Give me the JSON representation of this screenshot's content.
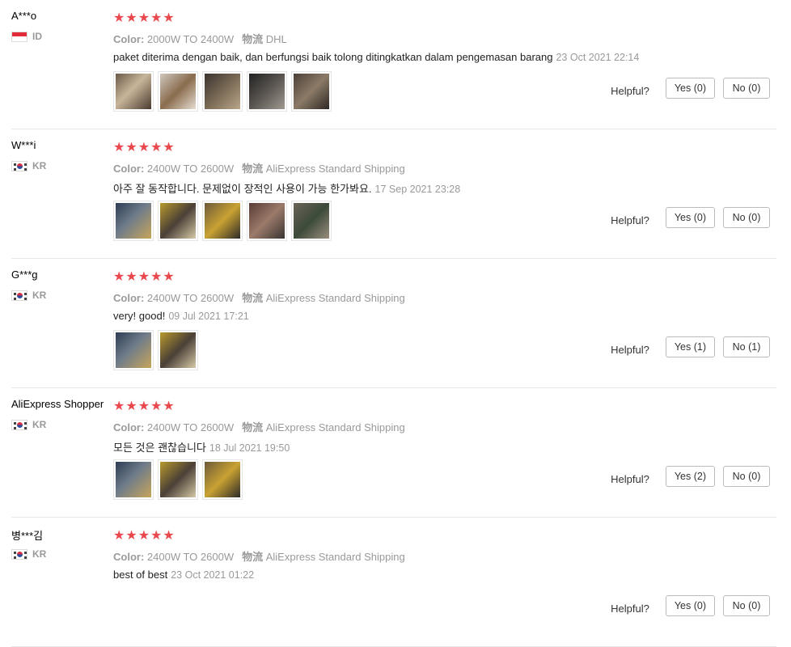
{
  "colors": {
    "star": "#e9484e",
    "muted": "#999999",
    "flag_id_red": "#e12b38"
  },
  "helpful_label": "Helpful?",
  "labels": {
    "color": "Color:",
    "shipping": "物流"
  },
  "reviews": [
    {
      "user": "A***o",
      "country": "ID",
      "flag_icon": "indonesia-flag-icon",
      "stars": "★★★★★",
      "color": "2000W TO 2400W",
      "shipping": "DHL",
      "text": "paket diterima dengan baik, dan berfungsi baik tolong ditingkatkan dalam pengemasan barang",
      "date": "23 Oct 2021 22:14",
      "yes": "Yes (0)",
      "no": "No (0)",
      "photos": [
        "photo-1",
        "photo-2",
        "photo-3",
        "photo-4",
        "photo-5"
      ]
    },
    {
      "user": "W***i",
      "country": "KR",
      "flag_icon": "korea-flag-icon",
      "stars": "★★★★★",
      "color": "2400W TO 2600W",
      "shipping": "AliExpress Standard Shipping",
      "text": "아주 잘 동작합니다. 문제없이 장적인 사용이 가능 한가봐요.",
      "date": "17 Sep 2021 23:28",
      "yes": "Yes (0)",
      "no": "No (0)",
      "photos": [
        "photo-1",
        "photo-2",
        "photo-3",
        "photo-4",
        "photo-5"
      ]
    },
    {
      "user": "G***g",
      "country": "KR",
      "flag_icon": "korea-flag-icon",
      "stars": "★★★★★",
      "color": "2400W TO 2600W",
      "shipping": "AliExpress Standard Shipping",
      "text": "very! good!",
      "date": "09 Jul 2021 17:21",
      "yes": "Yes (1)",
      "no": "No (1)",
      "photos": [
        "photo-1",
        "photo-2"
      ]
    },
    {
      "user": "AliExpress Shopper",
      "country": "KR",
      "flag_icon": "korea-flag-icon",
      "stars": "★★★★★",
      "color": "2400W TO 2600W",
      "shipping": "AliExpress Standard Shipping",
      "text": "모든 것은 괜찮습니다",
      "date": "18 Jul 2021 19:50",
      "yes": "Yes (2)",
      "no": "No (0)",
      "photos": [
        "photo-1",
        "photo-2",
        "photo-3"
      ]
    },
    {
      "user": "병***김",
      "country": "KR",
      "flag_icon": "korea-flag-icon",
      "stars": "★★★★★",
      "color": "2400W TO 2600W",
      "shipping": "AliExpress Standard Shipping",
      "text": "best of best",
      "date": "23 Oct 2021 01:22",
      "yes": "Yes (0)",
      "no": "No (0)",
      "photos": []
    }
  ]
}
